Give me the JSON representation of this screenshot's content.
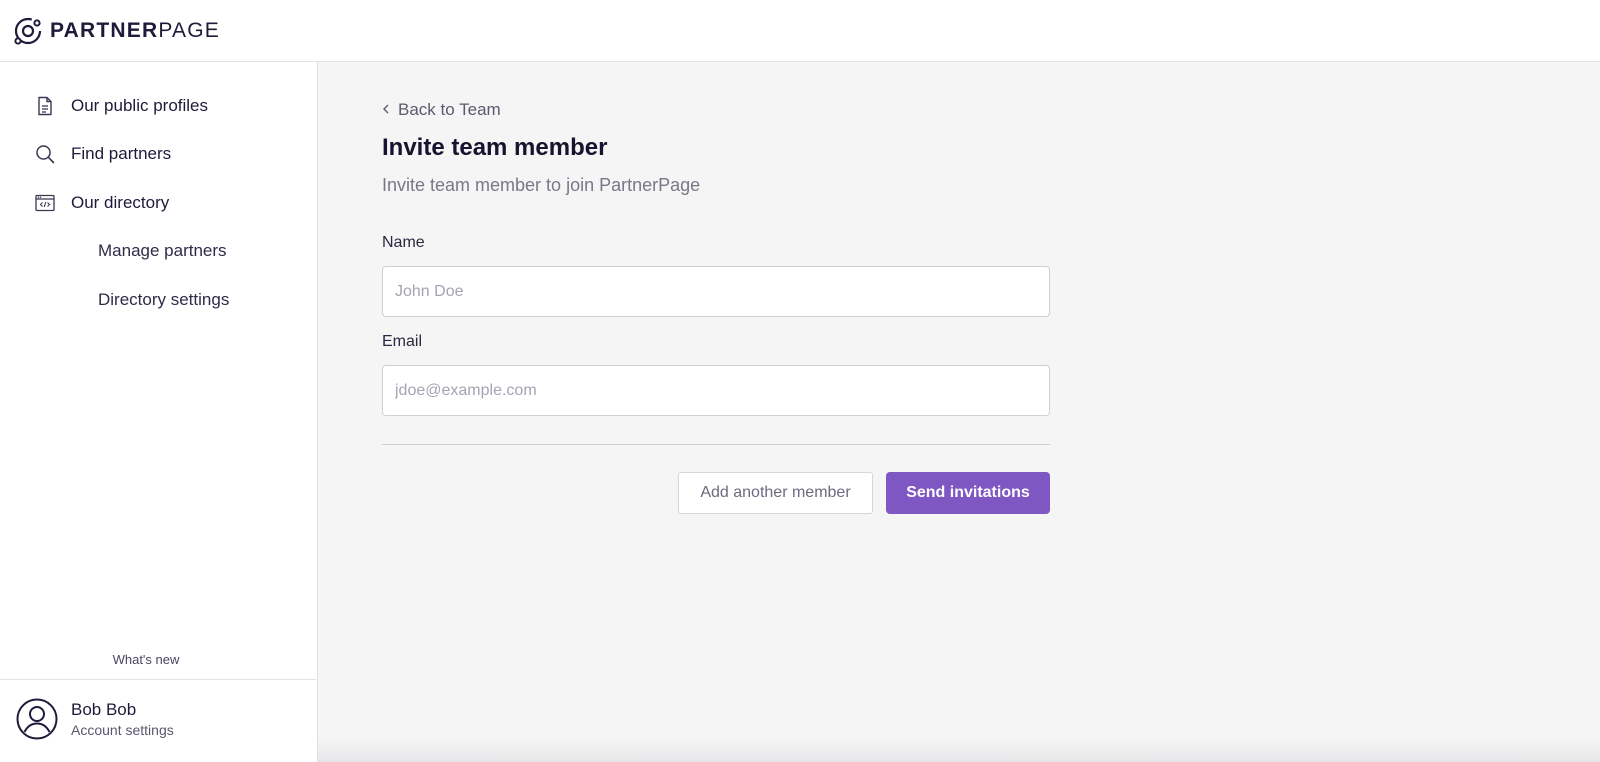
{
  "brand": {
    "name_bold": "PARTNER",
    "name_light": "PAGE"
  },
  "sidebar": {
    "items": [
      {
        "label": "Our public profiles",
        "icon": "document-icon"
      },
      {
        "label": "Find partners",
        "icon": "search-icon"
      },
      {
        "label": "Our directory",
        "icon": "code-window-icon"
      }
    ],
    "subitems": [
      {
        "label": "Manage partners"
      },
      {
        "label": "Directory settings"
      }
    ],
    "whats_new": "What's new",
    "account": {
      "name": "Bob Bob",
      "sub": "Account settings",
      "icon": "user-avatar-icon"
    }
  },
  "main": {
    "back_label": "Back to Team",
    "title": "Invite team member",
    "subtitle": "Invite team member to join PartnerPage",
    "form": {
      "name_label": "Name",
      "name_placeholder": "John Doe",
      "name_value": "",
      "email_label": "Email",
      "email_placeholder": "jdoe@example.com",
      "email_value": ""
    },
    "buttons": {
      "add_another": "Add another member",
      "send": "Send invitations"
    }
  },
  "colors": {
    "accent": "#7e57c2",
    "navy": "#1e1b3a",
    "background": "#f5f5f5"
  }
}
